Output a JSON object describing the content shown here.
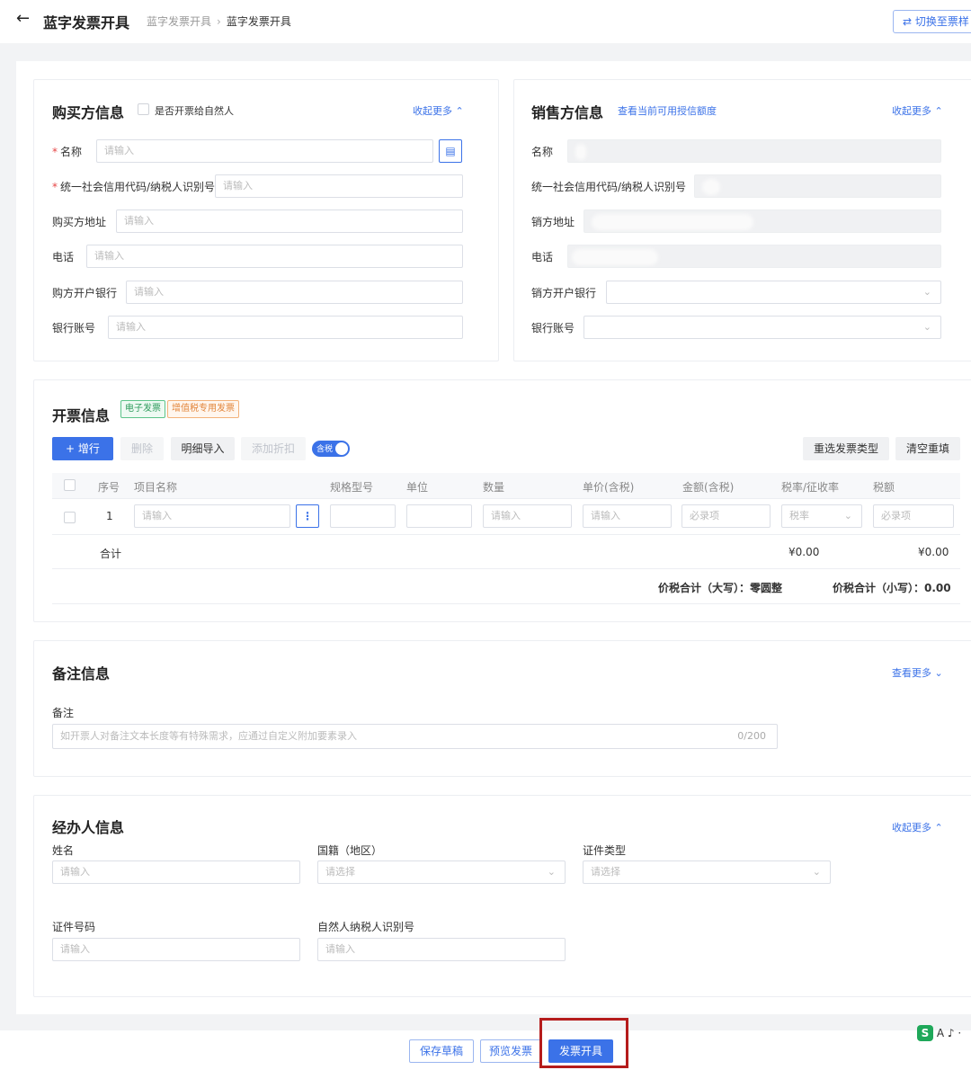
{
  "header": {
    "back_icon": "arrow-left-icon",
    "title": "蓝字发票开具",
    "breadcrumb": [
      "蓝字发票开具",
      "蓝字发票开具"
    ],
    "switch_label": "切换至票样"
  },
  "buyer": {
    "title": "购买方信息",
    "natural_person_checkbox_label": "是否开票给自然人",
    "collapse_link": "收起更多",
    "fields": [
      {
        "label": "名称",
        "required": true,
        "placeholder": "请输入"
      },
      {
        "label": "统一社会信用代码/纳税人识别号",
        "required": true,
        "placeholder": "请输入"
      },
      {
        "label": "购买方地址",
        "required": false,
        "placeholder": "请输入"
      },
      {
        "label": "电话",
        "required": false,
        "placeholder": "请输入"
      },
      {
        "label": "购方开户银行",
        "required": false,
        "placeholder": "请输入"
      },
      {
        "label": "银行账号",
        "required": false,
        "placeholder": "请输入"
      }
    ]
  },
  "seller": {
    "title": "销售方信息",
    "credit_link": "查看当前可用授信额度",
    "collapse_link": "收起更多",
    "fields": [
      {
        "label": "名称"
      },
      {
        "label": "统一社会信用代码/纳税人识别号"
      },
      {
        "label": "销方地址"
      },
      {
        "label": "电话"
      },
      {
        "label": "销方开户银行"
      },
      {
        "label": "银行账号"
      }
    ]
  },
  "invoice": {
    "title": "开票信息",
    "tags": [
      "电子发票",
      "增值税专用发票"
    ],
    "toolbar": {
      "add_row": "增行",
      "delete": "删除",
      "import_detail": "明细导入",
      "add_discount": "添加折扣",
      "tax_included_toggle": "含税",
      "reselect_type": "重选发票类型",
      "clear_refill": "清空重填"
    },
    "columns": [
      "序号",
      "项目名称",
      "规格型号",
      "单位",
      "数量",
      "单价(含税)",
      "金额(含税)",
      "税率/征收率",
      "税额"
    ],
    "rows": [
      {
        "index": "1",
        "name_placeholder": "请输入",
        "qty_placeholder": "请输入",
        "price_placeholder": "请输入",
        "amount_placeholder": "必录项",
        "rate_placeholder": "税率",
        "tax_placeholder": "必录项"
      }
    ],
    "total_label": "合计",
    "total_amount": "¥0.00",
    "total_tax": "¥0.00",
    "total_caps_label": "价税合计（大写）：",
    "total_caps_value": "零圆整",
    "total_small_label": "价税合计（小写）：",
    "total_small_value": "0.00"
  },
  "remark": {
    "title": "备注信息",
    "more_link": "查看更多",
    "label": "备注",
    "placeholder": "如开票人对备注文本长度等有特殊需求，应通过自定义附加要素录入",
    "counter": "0/200"
  },
  "agent": {
    "title": "经办人信息",
    "collapse_link": "收起更多",
    "fields": [
      {
        "label": "姓名",
        "placeholder": "请输入"
      },
      {
        "label": "国籍（地区）",
        "placeholder": "请选择"
      },
      {
        "label": "证件类型",
        "placeholder": "请选择"
      },
      {
        "label": "证件号码",
        "placeholder": "请输入"
      },
      {
        "label": "自然人纳税人识别号",
        "placeholder": "请输入"
      }
    ]
  },
  "footer": {
    "save_draft": "保存草稿",
    "preview": "预览发票",
    "issue": "发票开具",
    "logo_letter": "S",
    "logo_text": "A ♪ ·"
  },
  "colors": {
    "accent": "#3b72e8",
    "highlight": "#b51c1c",
    "required": "#e64545"
  }
}
